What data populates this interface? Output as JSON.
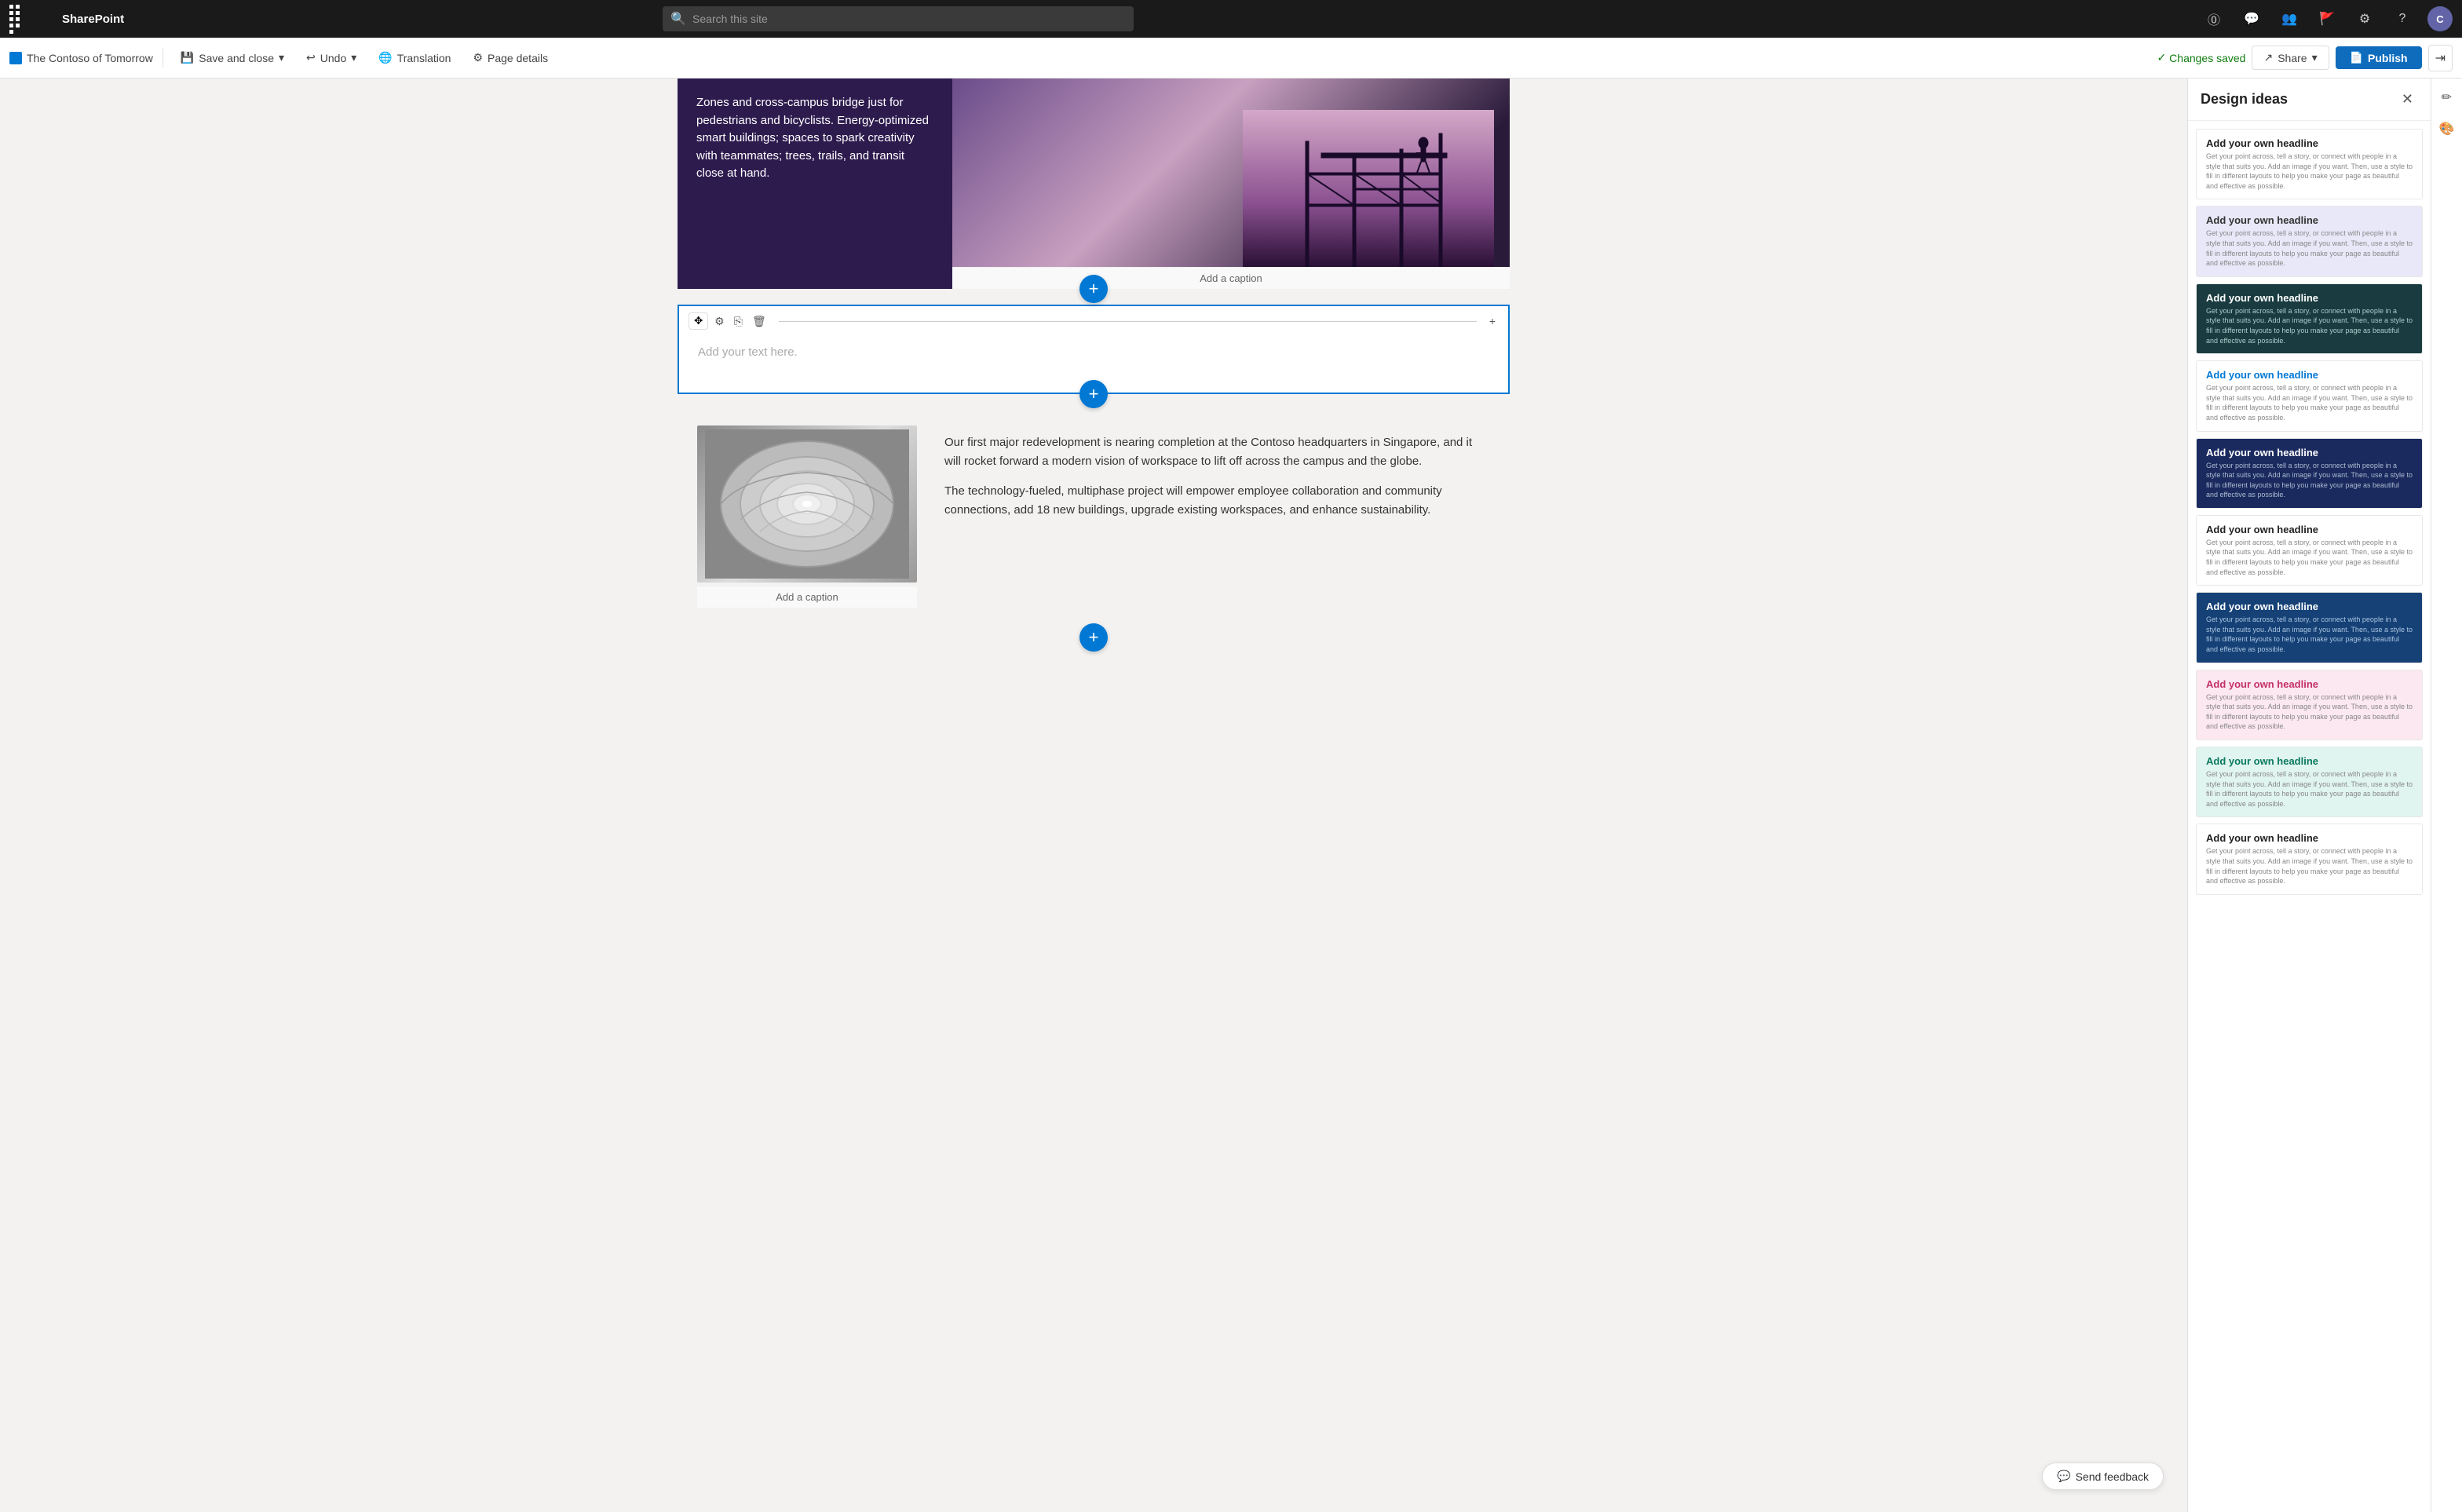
{
  "topnav": {
    "app_name": "SharePoint",
    "search_placeholder": "Search this site"
  },
  "toolbar": {
    "breadcrumb_label": "The Contoso of Tomorrow",
    "save_close_label": "Save and close",
    "undo_label": "Undo",
    "translation_label": "Translation",
    "page_details_label": "Page details",
    "changes_saved_label": "Changes saved",
    "share_label": "Share",
    "publish_label": "Publish"
  },
  "editor": {
    "hero_text": "Zones and cross-campus bridge just for pedestrians and bicyclists. Energy-optimized smart buildings; spaces to spark creativity with teammates; trees, trails, and transit close at hand.",
    "image_caption_1": "Add a caption",
    "text_placeholder": "Add your text here.",
    "image_caption_2": "Add a caption",
    "body_para_1": "Our first major redevelopment is nearing completion at the Contoso headquarters in Singapore, and it will rocket forward a modern vision of workspace to lift off across the campus and the globe.",
    "body_para_2": "The technology-fueled, multiphase project will empower employee collaboration and community connections, add 18 new buildings, upgrade existing workspaces, and enhance sustainability."
  },
  "design_ideas": {
    "panel_title": "Design ideas",
    "cards": [
      {
        "id": 1,
        "variant": "idea-white",
        "headline": "Add your own headline",
        "body": "Get your point across, tell a story, or connect with people in a style that suits you. Add an image if you want. Then, use a style to fill in different layouts to help you make your page as beautiful and effective as possible."
      },
      {
        "id": 2,
        "variant": "idea-lavender",
        "headline": "Add your own headline",
        "body": "Get your point across, tell a story, or connect with people in a style that suits you. Add an image if you want. Then, use a style to fill in different layouts to help you make your page as beautiful and effective as possible."
      },
      {
        "id": 3,
        "variant": "idea-dark-teal",
        "headline": "Add your own headline",
        "body": "Get your point across, tell a story, or connect with people in a style that suits you. Add an image if you want. Then, use a style to fill in different layouts to help you make your page as beautiful and effective as possible."
      },
      {
        "id": 4,
        "variant": "idea-light-blue-text",
        "headline": "Add your own headline",
        "body": "Get your point across, tell a story, or connect with people in a style that suits you. Add an image if you want. Then, use a style to fill in different layouts to help you make your page as beautiful and effective as possible."
      },
      {
        "id": 5,
        "variant": "idea-dark-navy",
        "headline": "Add your own headline",
        "body": "Get your point across, tell a story, or connect with people in a style that suits you. Add an image if you want. Then, use a style to fill in different layouts to help you make your page as beautiful and effective as possible."
      },
      {
        "id": 6,
        "variant": "idea-white-plain",
        "headline": "Add your own headline",
        "body": "Get your point across, tell a story, or connect with people in a style that suits you. Add an image if you want. Then, use a style to fill in different layouts to help you make your page as beautiful and effective as possible."
      },
      {
        "id": 7,
        "variant": "idea-dark-blue2",
        "headline": "Add your own headline",
        "body": "Get your point across, tell a story, or connect with people in a style that suits you. Add an image if you want. Then, use a style to fill in different layouts to help you make your page as beautiful and effective as possible."
      },
      {
        "id": 8,
        "variant": "idea-pink",
        "headline": "Add your own headline",
        "body": "Get your point across, tell a story, or connect with people in a style that suits you. Add an image if you want. Then, use a style to fill in different layouts to help you make your page as beautiful and effective as possible."
      },
      {
        "id": 9,
        "variant": "idea-teal-green",
        "headline": "Add your own headline",
        "body": "Get your point across, tell a story, or connect with people in a style that suits you. Add an image if you want. Then, use a style to fill in different layouts to help you make your page as beautiful and effective as possible."
      },
      {
        "id": 10,
        "variant": "idea-white-bottom",
        "headline": "Add your own headline",
        "body": "Get your point across, tell a story, or connect with people in a style that suits you. Add an image if you want. Then, use a style to fill in different layouts to help you make your page as beautiful and effective as possible."
      }
    ]
  },
  "feedback": {
    "send_feedback_label": "Send feedback"
  }
}
